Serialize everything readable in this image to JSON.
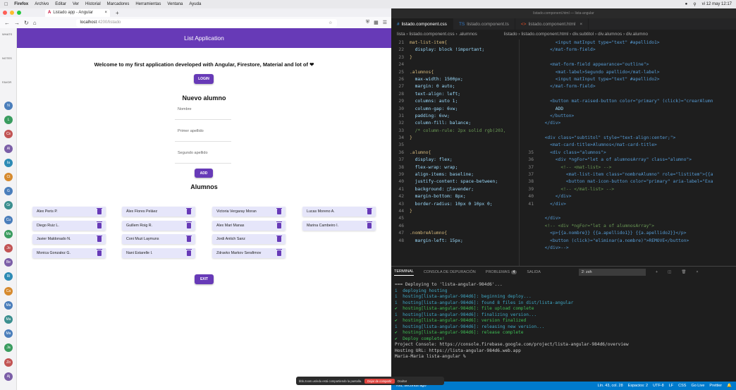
{
  "menubar": {
    "items": [
      "Firefox",
      "Archivo",
      "Editar",
      "Ver",
      "Historial",
      "Marcadores",
      "Herramientas",
      "Ventana",
      "Ayuda"
    ],
    "clock": "vi 12 may 12:17"
  },
  "firefox": {
    "tab_title": "Listado app - Angular",
    "url_host": "localhost",
    "url_rest": ":4200/listado"
  },
  "rail": {
    "labels": [
      "WHATS",
      "NOTES",
      "FAVOR"
    ],
    "items": [
      "N",
      "L",
      "Cs",
      "Al",
      "Ia",
      "Ct",
      "G",
      "Gr",
      "Cu",
      "Ma",
      "Jo",
      "Be",
      "Ri",
      "Ca",
      "Ma",
      "Ma",
      "Ma",
      "Ja",
      "Zo",
      "Aj"
    ]
  },
  "app": {
    "title": "List Application",
    "welcome": "Welcome to my first application developed with Angular, Firestore, Material and lot of ❤",
    "login_label": "LOGIN",
    "form_title": "Nuevo alumno",
    "fields": [
      "Nombre",
      "Primer apellido",
      "Segundo apellido"
    ],
    "add_label": "ADD",
    "list_title": "Alumnos",
    "exit_label": "EXIT",
    "students": [
      [
        "Alex Peris P.",
        "Diego Ruiz L.",
        "Javier Maldonado N.",
        "Monica Gonzalez G."
      ],
      [
        "Álex Flores Peláez",
        "Guillem Roig R.",
        "Coni Muzi Laymuns",
        "Nani Estarelle I."
      ],
      [
        "Victoria Vergaray Moran",
        "Alex Mari Manas",
        "Jordi Antich Sanz",
        "Zdravko Markov Serafimov"
      ],
      [
        "Lucas Moreno A.",
        "Marina Cambeiro I."
      ]
    ]
  },
  "share": {
    "text": "bbb.zoom.us/edu está compartiendo la pantalla.",
    "stop": "Dejar de compartir",
    "hide": "Ocultar"
  },
  "vscode": {
    "title": "listado.component.html — lista-angular",
    "tabs": [
      "listado.component.css",
      "listado.component.ts",
      "listado.component.html"
    ],
    "bread_left": "lista › listado.component.css › .alumnos",
    "bread_right": "listado › listado.component.html › div.subtitol › div.alumnos › div.alumno",
    "css_lines": [
      {
        "n": "21",
        "t": "mat-list-item{"
      },
      {
        "n": "22",
        "t": "  display: block !important;"
      },
      {
        "n": "23",
        "t": "}"
      },
      {
        "n": "24",
        "t": ""
      },
      {
        "n": "25",
        "t": ".alumnos{"
      },
      {
        "n": "26",
        "t": "  max-width: 1500px;"
      },
      {
        "n": "27",
        "t": "  margin: 0 auto;"
      },
      {
        "n": "28",
        "t": "  text-align: left;"
      },
      {
        "n": "29",
        "t": "  columns: auto 1;"
      },
      {
        "n": "30",
        "t": "  column-gap: 6vw;"
      },
      {
        "n": "31",
        "t": "  padding: 6vw;"
      },
      {
        "n": "32",
        "t": "  column-fill: balance;"
      },
      {
        "n": "33",
        "t": "  /* column-rule: 2px solid rgb(203,"
      },
      {
        "n": "34",
        "t": "}"
      },
      {
        "n": "35",
        "t": ""
      },
      {
        "n": "36",
        "t": ".alumno{"
      },
      {
        "n": "37",
        "t": "  display: flex;"
      },
      {
        "n": "38",
        "t": "  flex-wrap: wrap;"
      },
      {
        "n": "39",
        "t": "  align-items: baseline;"
      },
      {
        "n": "40",
        "t": "  justify-content: space-between;"
      },
      {
        "n": "41",
        "t": "  background: □lavender;"
      },
      {
        "n": "42",
        "t": "  margin-bottom: 8px;"
      },
      {
        "n": "43",
        "t": "  border-radius: 10px 0 10px 0;"
      },
      {
        "n": "44",
        "t": "}"
      },
      {
        "n": "45",
        "t": ""
      },
      {
        "n": "46",
        "t": ""
      },
      {
        "n": "47",
        "t": ".nombreAlumno{"
      },
      {
        "n": "48",
        "t": "  margin-left: 15px;"
      }
    ],
    "html_lines": [
      {
        "n": "",
        "t": "      <input matInput type=\"text\" #apellido1>"
      },
      {
        "n": "",
        "t": "    </mat-form-field>"
      },
      {
        "n": "",
        "t": ""
      },
      {
        "n": "",
        "t": "    <mat-form-field appearance=\"outline\">"
      },
      {
        "n": "",
        "t": "      <mat-label>Segundo apellido</mat-label>"
      },
      {
        "n": "",
        "t": "      <input matInput type=\"text\" #apellido2>"
      },
      {
        "n": "",
        "t": "    </mat-form-field>"
      },
      {
        "n": "",
        "t": ""
      },
      {
        "n": "",
        "t": "    <button mat-raised-button color=\"primary\" (click)=\"crearAlumn"
      },
      {
        "n": "",
        "t": "      ADD"
      },
      {
        "n": "",
        "t": "    </button>"
      },
      {
        "n": "",
        "t": "  </div>"
      },
      {
        "n": "",
        "t": ""
      },
      {
        "n": "",
        "t": "  <div class=\"subtitol\" style=\"text-align:center;\">"
      },
      {
        "n": "",
        "t": "    <mat-card-title>Alumnos</mat-card-title>"
      },
      {
        "n": "35",
        "t": "    <div class=\"alumnos\">"
      },
      {
        "n": "36",
        "t": "      <div *ngFor=\"let a of alumnosArray\" class=\"alumno\">"
      },
      {
        "n": "37",
        "t": "        <!-- <mat-list> -->"
      },
      {
        "n": "37",
        "t": "          <mat-list-item class=\"nombreAlumno\" role=\"listitem\">{{a"
      },
      {
        "n": "38",
        "t": "          <button mat-icon-button color=\"primary\" aria-label=\"Exa"
      },
      {
        "n": "39",
        "t": "        <!-- </mat-list> -->"
      },
      {
        "n": "40",
        "t": "      </div>"
      },
      {
        "n": "41",
        "t": "    </div>"
      },
      {
        "n": "",
        "t": ""
      },
      {
        "n": "",
        "t": "  </div>"
      },
      {
        "n": "",
        "t": "  <!-- <div *ngFor=\"let a of alumnosArray\">"
      },
      {
        "n": "",
        "t": "    <p>{{a.nombre}} {{a.apellido1}} {{a.apellido2}}</p>"
      },
      {
        "n": "",
        "t": "    <button (click)=\"eliminar(a.nombre)\">REMOVE</button>"
      },
      {
        "n": "",
        "t": "  </div>-->"
      },
      {
        "n": "",
        "t": ""
      }
    ],
    "terminal": {
      "tabs": [
        "TERMINAL",
        "CONSOLA DE DEPURACIÓN",
        "PROBLEMAS",
        "SALIDA"
      ],
      "problems": "4",
      "shell": "2: zsh",
      "lines": [
        "=== Deploying to 'lista-angular-984d6'...",
        "",
        "i  deploying hosting",
        "i  hosting[lista-angular-984d6]: beginning deploy...",
        "i  hosting[lista-angular-984d6]: found 8 files in dist/lista-angular",
        "✔  hosting[lista-angular-984d6]: file upload complete",
        "i  hosting[lista-angular-984d6]: finalizing version...",
        "✔  hosting[lista-angular-984d6]: version finalized",
        "i  hosting[lista-angular-984d6]: releasing new version...",
        "✔  hosting[lista-angular-984d6]: release complete",
        "",
        "✔  Deploy complete!",
        "",
        "Project Console: https://console.firebase.google.com/project/lista-angular-984d6/overview",
        "Hosting URL: https://lista-angular-984d6.web.app",
        "Maria-Maria lista-angular % "
      ]
    },
    "status": {
      "left": "You, seconds ago",
      "pos": "Lín. 43, col. 28",
      "spaces": "Espacios: 2",
      "enc": "UTF-8",
      "eol": "LF",
      "lang": "CSS",
      "live": "Go Live",
      "prettier": "Prettier"
    }
  }
}
